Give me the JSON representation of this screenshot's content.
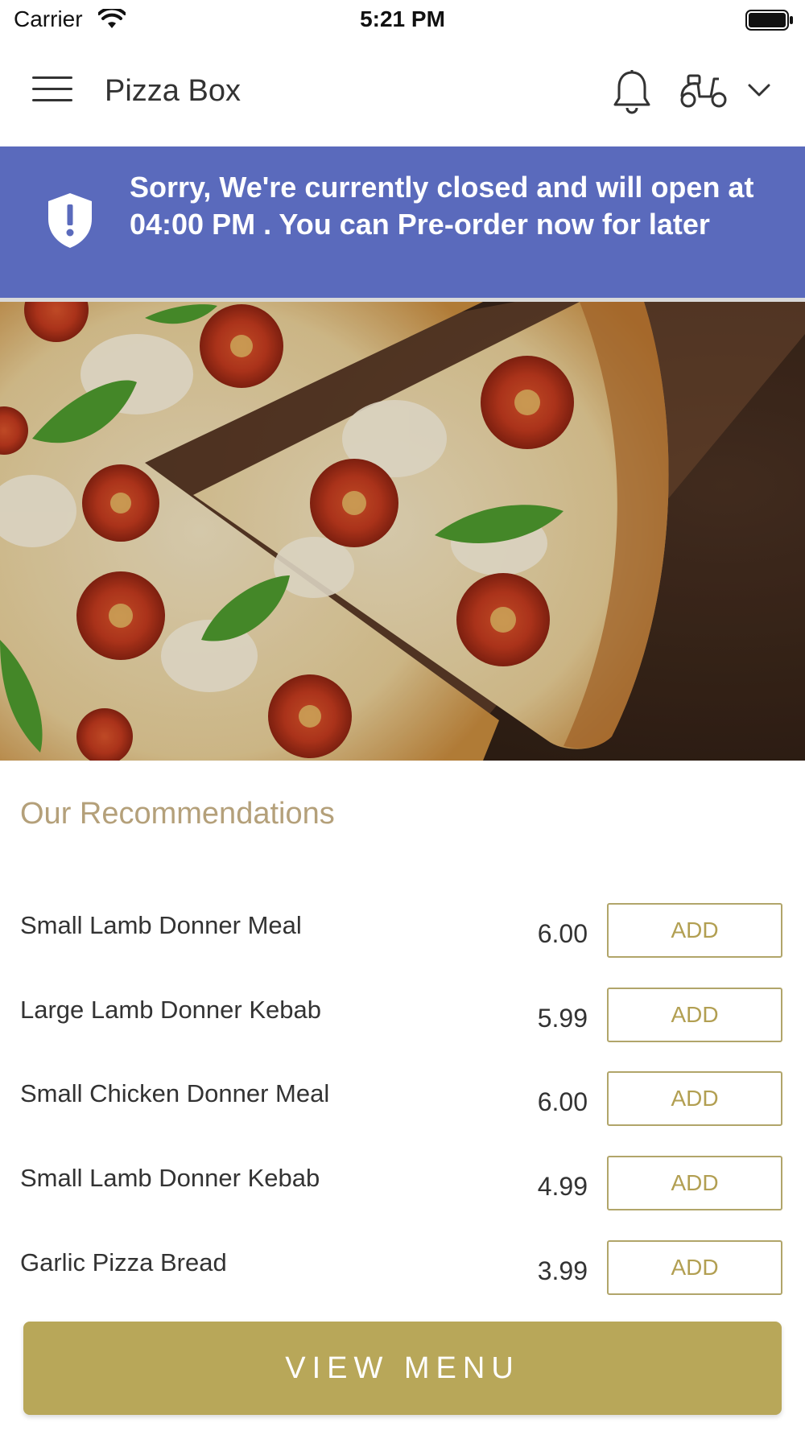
{
  "status_bar": {
    "carrier": "Carrier",
    "time": "5:21 PM"
  },
  "header": {
    "title": "Pizza Box"
  },
  "banner": {
    "message": "Sorry, We're currently closed and will open at 04:00 PM . You can Pre-order now for later"
  },
  "recommendations": {
    "title": "Our Recommendations",
    "items": [
      {
        "name": "Small Lamb Donner Meal",
        "price": "6.00",
        "action": "ADD"
      },
      {
        "name": "Large Lamb Donner Kebab",
        "price": "5.99",
        "action": "ADD"
      },
      {
        "name": "Small Chicken Donner Meal",
        "price": "6.00",
        "action": "ADD"
      },
      {
        "name": "Small Lamb Donner Kebab",
        "price": "4.99",
        "action": "ADD"
      },
      {
        "name": "Garlic Pizza Bread",
        "price": "3.99",
        "action": "ADD"
      }
    ]
  },
  "footer": {
    "view_menu_label": "VIEW MENU"
  },
  "colors": {
    "banner": "#5a6abc",
    "accent": "#b8a759",
    "title_muted": "#b4a07a"
  }
}
